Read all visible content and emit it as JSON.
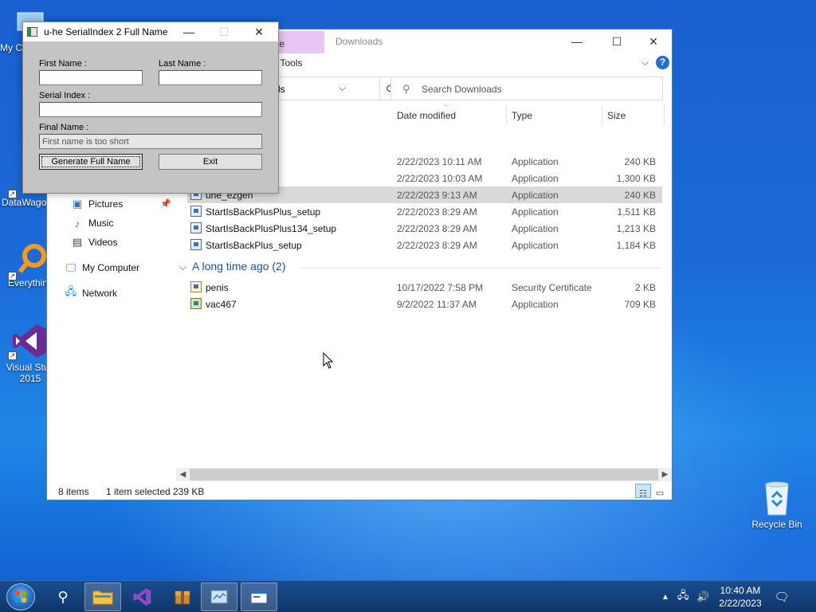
{
  "desktop": {
    "icons": [
      {
        "label": "My C",
        "icon": "computer-icon"
      },
      {
        "label": "DataWago",
        "icon": "database-icon"
      },
      {
        "label": "Everythin",
        "icon": "magnifier-icon"
      },
      {
        "label": "Visual Stud\n2015",
        "icon": "visual-studio-icon"
      },
      {
        "label": "Recycle Bin",
        "icon": "recycle-bin-icon"
      }
    ]
  },
  "explorer": {
    "ribbon_tab_manage": "age",
    "path_title": "Downloads",
    "ribbon_tools": "on Tools",
    "address_text": "ds",
    "search_placeholder": "Search Downloads",
    "nav": [
      {
        "label": "Pictures",
        "icon": "pictures-icon",
        "pinned": true
      },
      {
        "label": "Music",
        "icon": "music-icon"
      },
      {
        "label": "Videos",
        "icon": "videos-icon"
      },
      {
        "label": "My Computer",
        "icon": "computer-icon"
      },
      {
        "label": "Network",
        "icon": "network-icon"
      }
    ],
    "columns": {
      "date": "Date modified",
      "type": "Type",
      "size": "Size"
    },
    "files_recent": [
      {
        "name": "",
        "date": "2/22/2023 10:11 AM",
        "type": "Application",
        "size": "240 KB"
      },
      {
        "name": "",
        "date": "2/22/2023 10:03 AM",
        "type": "Application",
        "size": "1,300 KB"
      },
      {
        "name": "uhe_ezgen",
        "date": "2/22/2023 9:13 AM",
        "type": "Application",
        "size": "240 KB",
        "selected": true
      },
      {
        "name": "StartIsBackPlusPlus_setup",
        "date": "2/22/2023 8:29 AM",
        "type": "Application",
        "size": "1,511 KB"
      },
      {
        "name": "StartIsBackPlusPlus134_setup",
        "date": "2/22/2023 8:29 AM",
        "type": "Application",
        "size": "1,213 KB"
      },
      {
        "name": "StartIsBackPlus_setup",
        "date": "2/22/2023 8:29 AM",
        "type": "Application",
        "size": "1,184 KB"
      }
    ],
    "group_old_label": "A long time ago (2)",
    "files_old": [
      {
        "name": "penis",
        "date": "10/17/2022 7:58 PM",
        "type": "Security Certificate",
        "size": "2 KB"
      },
      {
        "name": "vac467",
        "date": "9/2/2022 11:37 AM",
        "type": "Application",
        "size": "709 KB"
      }
    ],
    "status": {
      "items": "8 items",
      "selected": "1 item selected",
      "size": "239 KB"
    }
  },
  "dialog": {
    "title": "u-he SerialIndex 2 Full Name",
    "first_name_label": "First Name :",
    "last_name_label": "Last Name :",
    "serial_label": "Serial Index :",
    "final_label": "Final Name :",
    "first_name_value": "",
    "last_name_value": "",
    "serial_value": "",
    "final_value": "First name is too short",
    "generate_label": "Generate Full Name",
    "exit_label": "Exit"
  },
  "taskbar": {
    "time": "10:40 AM",
    "date": "2/22/2023"
  }
}
